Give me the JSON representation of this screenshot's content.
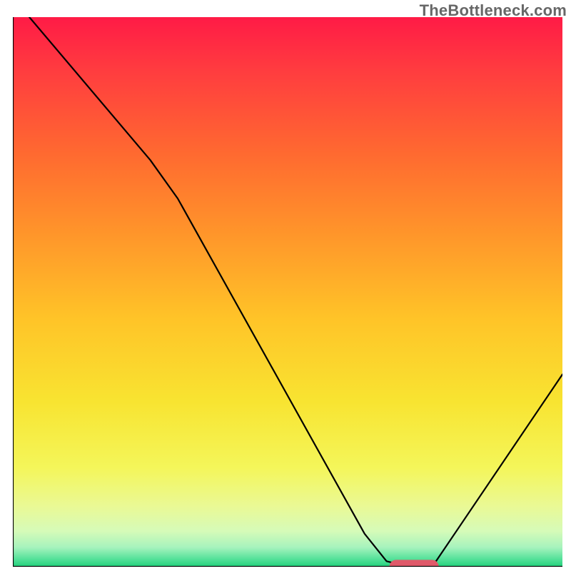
{
  "watermark": "TheBottleneck.com",
  "chart_data": {
    "type": "line",
    "title": "",
    "xlabel": "",
    "ylabel": "",
    "xlim": [
      0,
      100
    ],
    "ylim": [
      0,
      100
    ],
    "grid": false,
    "background": {
      "gradient_stops": [
        {
          "offset": 0.0,
          "color": "#ff1b46"
        },
        {
          "offset": 0.1,
          "color": "#ff3d3f"
        },
        {
          "offset": 0.25,
          "color": "#ff6a30"
        },
        {
          "offset": 0.4,
          "color": "#ff972a"
        },
        {
          "offset": 0.55,
          "color": "#ffc428"
        },
        {
          "offset": 0.7,
          "color": "#f8e431"
        },
        {
          "offset": 0.82,
          "color": "#f4f65a"
        },
        {
          "offset": 0.89,
          "color": "#eaf995"
        },
        {
          "offset": 0.935,
          "color": "#d6fbb8"
        },
        {
          "offset": 0.965,
          "color": "#a6f3bd"
        },
        {
          "offset": 0.985,
          "color": "#58e29b"
        },
        {
          "offset": 1.0,
          "color": "#23d27c"
        }
      ]
    },
    "series": [
      {
        "name": "performance-curve",
        "color": "#000000",
        "stroke_width": 2.2,
        "points": [
          {
            "x": 3,
            "y": 100
          },
          {
            "x": 25,
            "y": 74
          },
          {
            "x": 30,
            "y": 67
          },
          {
            "x": 64,
            "y": 6
          },
          {
            "x": 68,
            "y": 1
          },
          {
            "x": 72,
            "y": 0
          },
          {
            "x": 77,
            "y": 1
          },
          {
            "x": 100,
            "y": 35
          }
        ]
      }
    ],
    "marker": {
      "name": "target-marker",
      "color": "#e05a6a",
      "x_center": 73,
      "y": 0,
      "width": 9,
      "height": 2.5
    },
    "axes": {
      "box": false,
      "left": true,
      "bottom": true,
      "color": "#000000",
      "stroke_width": 2.2
    }
  }
}
